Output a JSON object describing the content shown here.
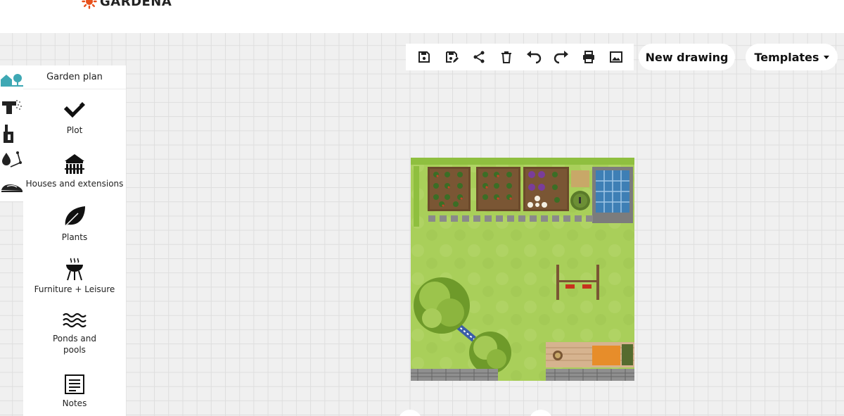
{
  "brand": {
    "name": "GARDENA",
    "logo_color": "#e8501b"
  },
  "toolbar": {
    "tools": [
      {
        "name": "save-icon",
        "title": "Save"
      },
      {
        "name": "save-as-icon",
        "title": "Save as"
      },
      {
        "name": "share-icon",
        "title": "Share"
      },
      {
        "name": "trash-icon",
        "title": "Delete"
      },
      {
        "name": "undo-icon",
        "title": "Undo"
      },
      {
        "name": "redo-icon",
        "title": "Redo"
      },
      {
        "name": "print-icon",
        "title": "Print"
      },
      {
        "name": "image-icon",
        "title": "Export image"
      }
    ],
    "new_drawing_label": "New drawing",
    "templates_label": "Templates"
  },
  "rail": {
    "items": [
      {
        "name": "garden-plan-rail-icon",
        "active": true
      },
      {
        "name": "irrigation-rail-icon"
      },
      {
        "name": "water-tap-rail-icon"
      },
      {
        "name": "sprinkler-rail-icon"
      },
      {
        "name": "robotic-mower-rail-icon"
      }
    ],
    "accent": "#3ea8b4"
  },
  "panel": {
    "title": "Garden plan",
    "categories": [
      {
        "label": "Plot",
        "icon": "plot-icon"
      },
      {
        "label": "Houses and extensions",
        "icon": "house-icon"
      },
      {
        "label": "Plants",
        "icon": "leaf-icon"
      },
      {
        "label": "Furniture + Leisure",
        "icon": "barbecue-icon"
      },
      {
        "label": "Ponds and pools",
        "icon": "waves-icon"
      },
      {
        "label": "Notes",
        "icon": "notes-icon"
      }
    ]
  },
  "plan": {
    "lawn_color": "#a9cf5a",
    "elements": [
      "vegetable-bed",
      "vegetable-bed",
      "cabbage-bed",
      "compost",
      "rain-barrel",
      "greenhouse",
      "swing",
      "tree",
      "tree",
      "wooden-deck",
      "stone-wall"
    ]
  }
}
